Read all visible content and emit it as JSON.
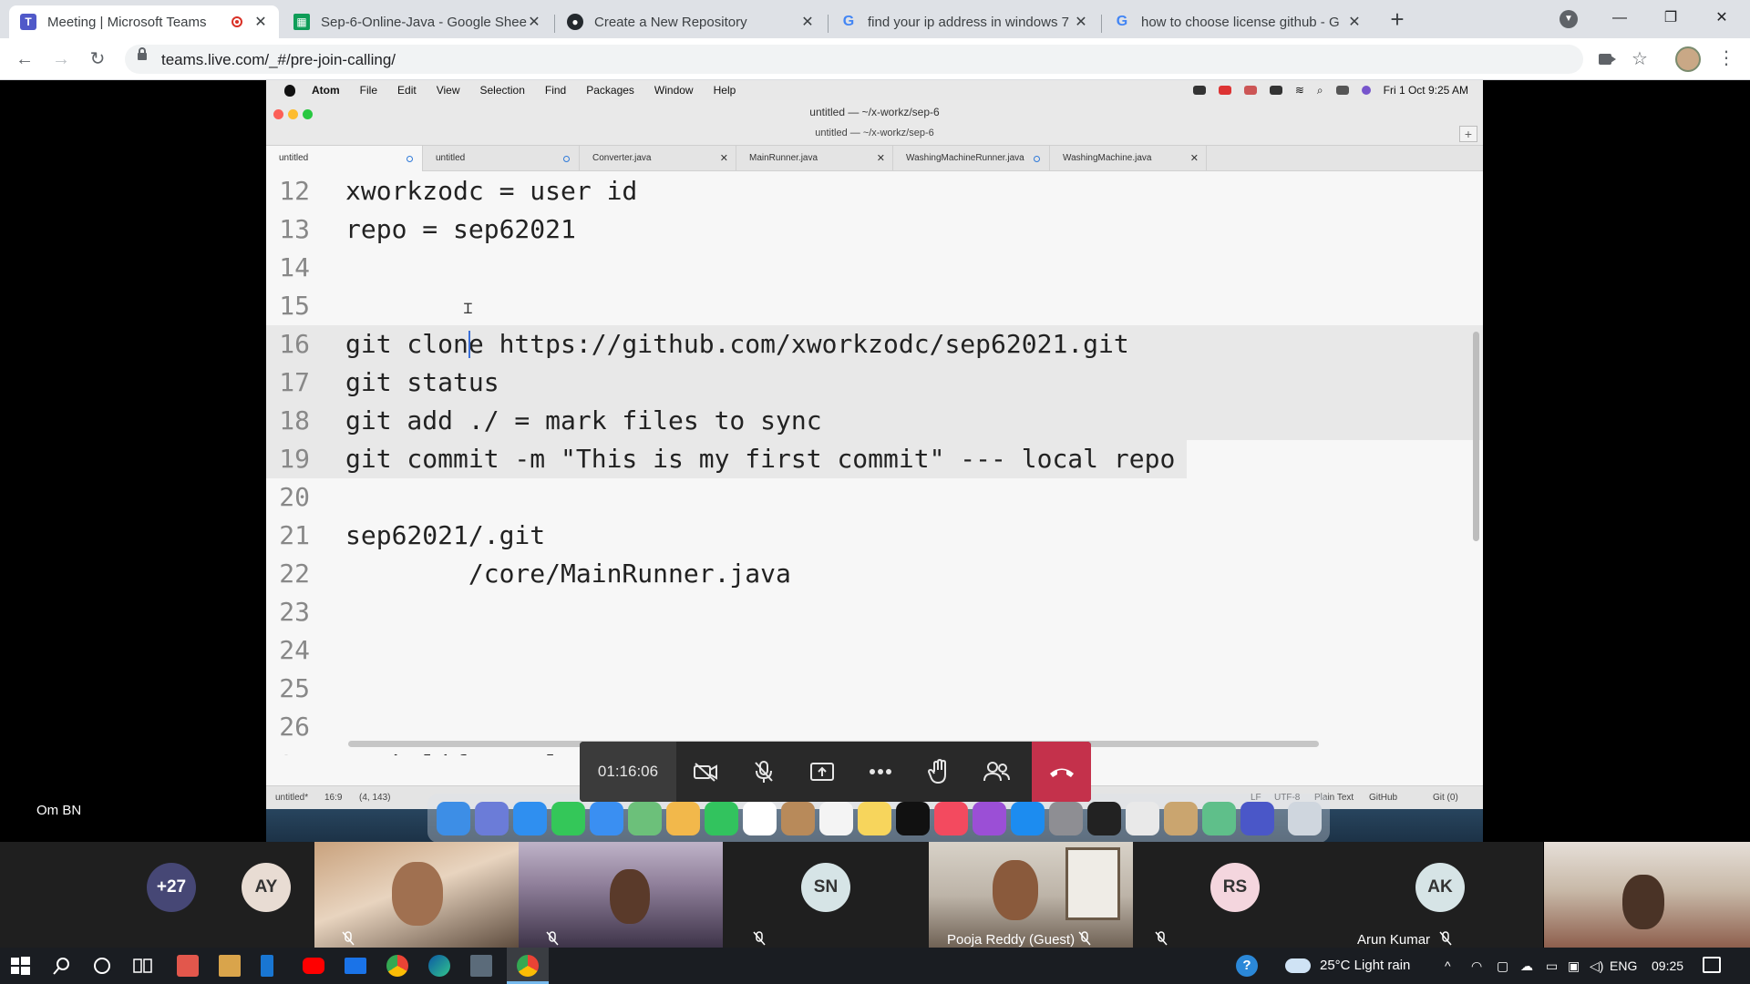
{
  "browser": {
    "tabs": [
      {
        "title": "Meeting | Microsoft Teams",
        "icon": "teams-icon",
        "active": true
      },
      {
        "title": "Sep-6-Online-Java - Google Shee",
        "icon": "sheets-icon"
      },
      {
        "title": "Create a New Repository",
        "icon": "github-icon"
      },
      {
        "title": "find your ip address in windows 7",
        "icon": "google-icon"
      },
      {
        "title": "how to choose license github - G",
        "icon": "google-icon"
      }
    ],
    "url": "teams.live.com/_#/pre-join-calling/"
  },
  "mac": {
    "menu": [
      "Atom",
      "File",
      "Edit",
      "View",
      "Selection",
      "Find",
      "Packages",
      "Window",
      "Help"
    ],
    "clock": "Fri 1 Oct  9:25 AM"
  },
  "atom": {
    "window_title": "untitled — ~/x-workz/sep-6",
    "sub_title": "untitled — ~/x-workz/sep-6",
    "tabs": [
      "untitled",
      "untitled",
      "Converter.java",
      "MainRunner.java",
      "WashingMachineRunner.java",
      "WashingMachine.java"
    ],
    "lines": [
      {
        "n": "12",
        "text": "xworkzodc = user id"
      },
      {
        "n": "13",
        "text": "repo = sep62021"
      },
      {
        "n": "14",
        "text": ""
      },
      {
        "n": "15",
        "text": ""
      },
      {
        "n": "16",
        "text": "git clone https://github.com/xworkzodc/sep62021.git"
      },
      {
        "n": "17",
        "text": "git status"
      },
      {
        "n": "18",
        "text": "git add ./ = mark files to sync"
      },
      {
        "n": "19",
        "text": "git commit -m \"This is my first commit\" --- local repo"
      },
      {
        "n": "20",
        "text": ""
      },
      {
        "n": "21",
        "text": "sep62021/.git"
      },
      {
        "n": "22",
        "text": "        /core/MainRunner.java"
      },
      {
        "n": "23",
        "text": ""
      },
      {
        "n": "24",
        "text": ""
      },
      {
        "n": "25",
        "text": ""
      },
      {
        "n": "26",
        "text": ""
      },
      {
        "n": "27",
        "text": "Work life cycle"
      }
    ],
    "status_left": "untitled*",
    "status_pos": "16:9",
    "status_sel": "(4, 143)",
    "status_right": [
      "LF",
      "UTF-8",
      "Plain Text",
      "GitHub",
      "Git (0)"
    ]
  },
  "meeting": {
    "timer": "01:16:06",
    "presenter": "Om BN",
    "participants": [
      {
        "label": "+27",
        "type": "count",
        "color": "#464775",
        "fg": "#ffffff"
      },
      {
        "label": "AY",
        "type": "avatar",
        "color": "#e8dcd3",
        "fg": "#333333"
      },
      {
        "label": "",
        "type": "video"
      },
      {
        "label": "",
        "type": "video"
      },
      {
        "label": "SN",
        "type": "avatar",
        "color": "#d6e4e6",
        "fg": "#333333"
      },
      {
        "label": "Pooja Reddy (Guest)",
        "type": "video"
      },
      {
        "label": "RS",
        "type": "avatar",
        "color": "#f4d6de",
        "fg": "#333333"
      },
      {
        "label": "AK",
        "type": "avatar",
        "color": "#d6e4e6",
        "fg": "#333333",
        "name": "Arun Kumar"
      },
      {
        "label": "",
        "type": "video"
      }
    ]
  },
  "taskbar": {
    "weather": "25°C  Light rain",
    "lang": "ENG",
    "time": "09:25"
  }
}
